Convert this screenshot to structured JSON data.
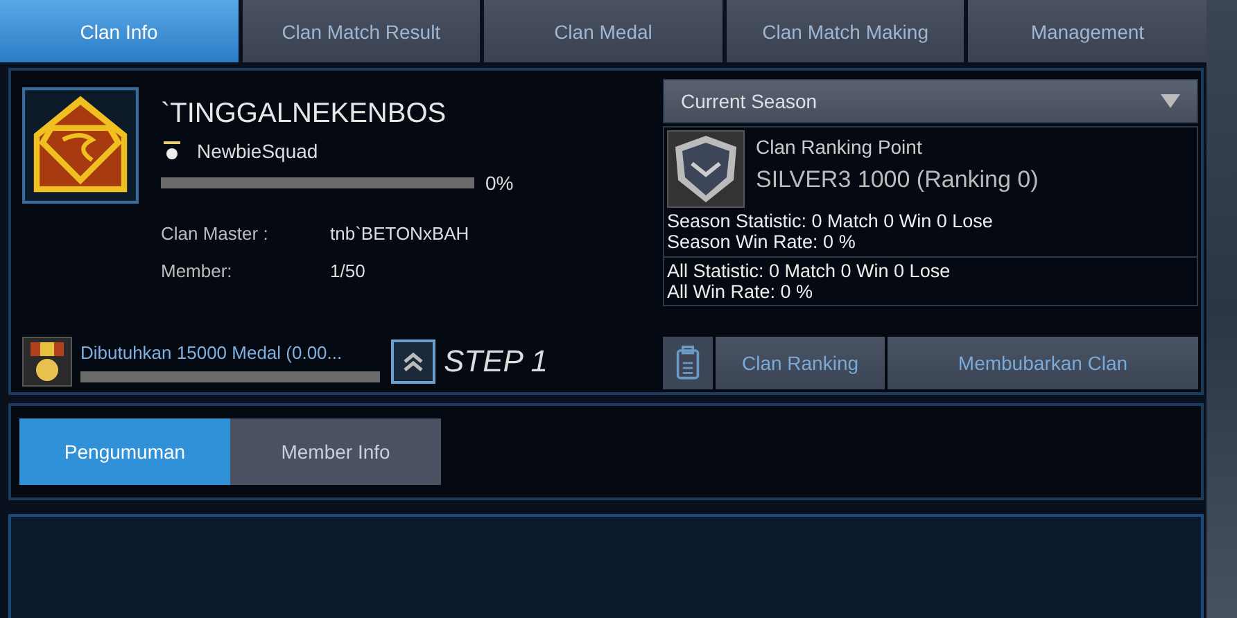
{
  "tabs": [
    {
      "label": "Clan Info",
      "selected": true
    },
    {
      "label": "Clan Match Result",
      "selected": false
    },
    {
      "label": "Clan Medal",
      "selected": false
    },
    {
      "label": "Clan Match Making",
      "selected": false
    },
    {
      "label": "Management",
      "selected": false
    }
  ],
  "clan": {
    "name": "`TINGGALNEKENBOS",
    "rank": "NewbieSquad",
    "exp": {
      "level": 0,
      "reading": "0%"
    },
    "details": [
      {
        "label": "Clan Master :",
        "value": "tnb`BETONxBAH"
      },
      {
        "label": "Member:",
        "value": "1/50"
      }
    ],
    "medal": {
      "text": "Dibutuhkan 15000 Medal (0.00...",
      "level": 0
    },
    "step": "STEP 1"
  },
  "season": {
    "dropdown": "Current Season",
    "point_label": "Clan Ranking Point",
    "point_value": "SILVER3 1000 (Ranking 0)",
    "season_stats": [
      "Season Statistic: 0 Match 0 Win 0 Lose",
      "Season Win Rate: 0 %"
    ],
    "all_stats": [
      "All Statistic: 0 Match 0 Win 0 Lose",
      "All Win Rate: 0 %"
    ],
    "buttons": [
      "Clan Ranking",
      "Membubarkan Clan"
    ]
  },
  "subtabs": [
    {
      "label": "Pengumuman",
      "selected": true
    },
    {
      "label": "Member Info",
      "selected": false
    }
  ]
}
